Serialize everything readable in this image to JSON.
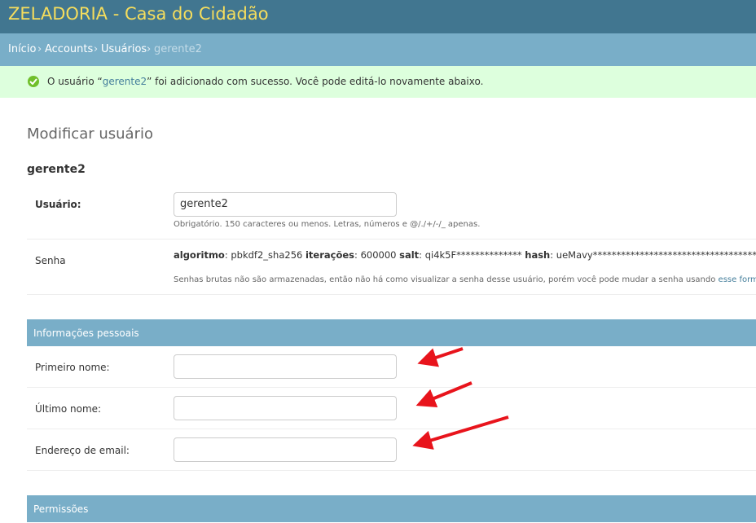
{
  "header": {
    "site_title": "ZELADORIA - Casa do Cidadão"
  },
  "breadcrumbs": {
    "items": [
      "Início",
      "Accounts",
      "Usuários"
    ],
    "separator": "›",
    "current": "gerente2"
  },
  "message": {
    "text_before": "O usuário “",
    "link_text": "gerente2",
    "text_after": "” foi adicionado com sucesso. Você pode editá-lo novamente abaixo.",
    "icon": "check-circle-icon"
  },
  "page": {
    "title": "Modificar usuário",
    "object_name": "gerente2"
  },
  "fields": {
    "username": {
      "label": "Usuário:",
      "value": "gerente2",
      "help": "Obrigatório. 150 caracteres ou menos. Letras, números e @/./+/-/_ apenas."
    },
    "password": {
      "label": "Senha",
      "algorithm_label": "algoritmo",
      "algorithm_value": "pbkdf2_sha256",
      "iterations_label": "iterações",
      "iterations_value": "600000",
      "salt_label": "salt",
      "salt_value": "qi4k5F**************",
      "hash_label": "hash",
      "hash_value": "ueMavy**************************************",
      "help_before": "Senhas brutas não são armazenadas, então não há como visualizar a senha desse usuário, porém você pode mudar a senha usando ",
      "help_link": "esse form",
      "help_after": "."
    }
  },
  "personal_info": {
    "caption": "Informações pessoais",
    "first_name": {
      "label": "Primeiro nome:",
      "value": ""
    },
    "last_name": {
      "label": "Último nome:",
      "value": ""
    },
    "email": {
      "label": "Endereço de email:",
      "value": ""
    }
  },
  "permissions": {
    "caption": "Permissões"
  },
  "colors": {
    "header_bg": "#417690",
    "title_yellow": "#f5dd5d",
    "breadcrumb_bg": "#79aec8",
    "success_bg": "#ddffdd",
    "success_icon": "#70bf2b",
    "annotation_arrow": "#e8141c"
  }
}
